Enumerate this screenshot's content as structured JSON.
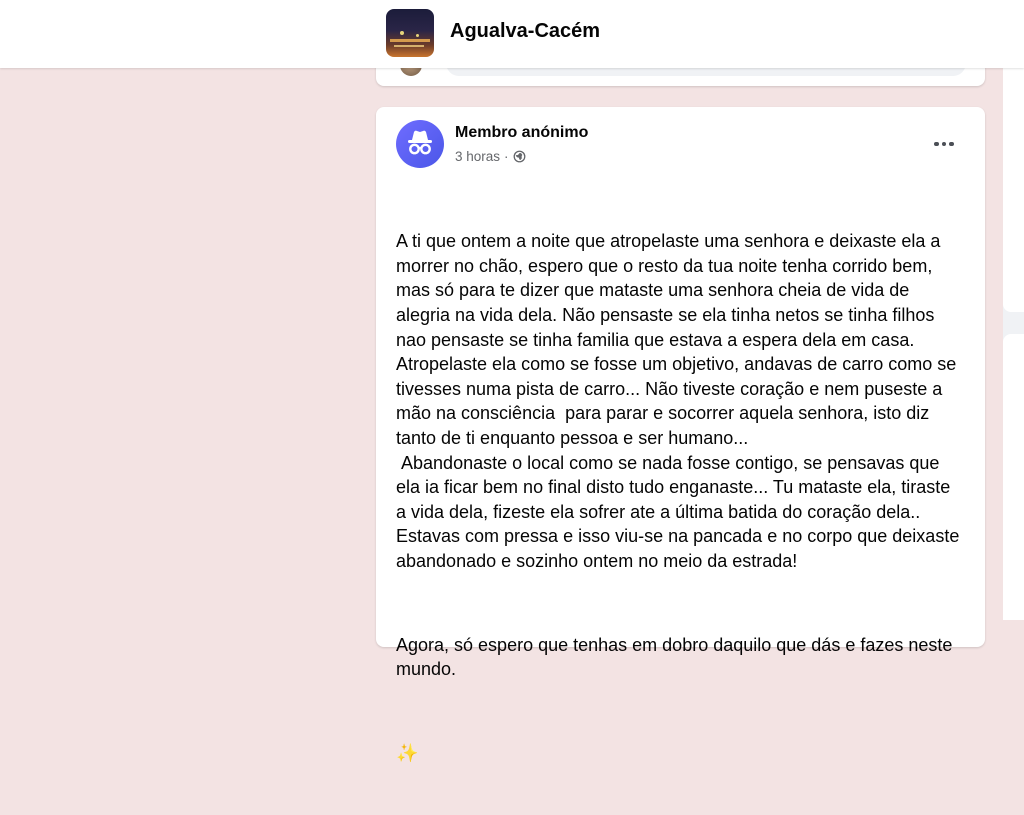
{
  "group": {
    "name": "Agualva-Cacém"
  },
  "post": {
    "author": "Membro anónimo",
    "time": "3 horas",
    "separator": "·",
    "paragraphs": [
      "A ti que ontem a noite que atropelaste uma senhora e deixaste ela a morrer no chão, espero que o resto da tua noite tenha corrido bem, mas só para te dizer que mataste uma senhora cheia de vida de alegria na vida dela. Não pensaste se ela tinha netos se tinha filhos nao pensaste se tinha familia que estava a espera dela em casa. Atropelaste ela como se fosse um objetivo, andavas de carro como se tivesses numa pista de carro... Não tiveste coração e nem puseste a mão na consciência  para parar e socorrer aquela senhora, isto diz tanto de ti enquanto pessoa e ser humano...\n Abandonaste o local como se nada fosse contigo, se pensavas que ela ia ficar bem no final disto tudo enganaste... Tu mataste ela, tiraste a vida dela, fizeste ela sofrer ate a última batida do coração dela.. Estavas com pressa e isso viu-se na pancada e no corpo que deixaste abandonado e sozinho ontem no meio da estrada!",
      "Agora, só espero que tenhas em dobro daquilo que dás e fazes neste mundo."
    ],
    "emoji": "✨"
  },
  "icons": {
    "avatar": "incognito-icon",
    "privacy": "globe-icon",
    "more": "more-options-icon"
  },
  "colors": {
    "background": "#f3e3e3",
    "card": "#ffffff",
    "avatar": "#5b5ff0",
    "secondary_text": "#65676b"
  }
}
